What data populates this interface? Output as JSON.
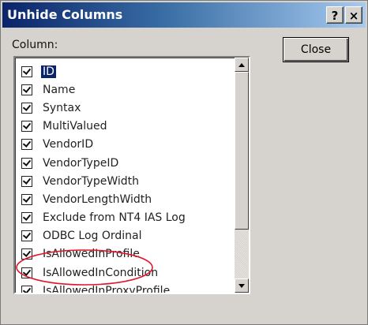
{
  "window": {
    "title": "Unhide Columns",
    "help_button": "?",
    "close_glyph": "×"
  },
  "columns_label": "Column:",
  "close_button_label": "Close",
  "columns": [
    {
      "label": "ID",
      "checked": true,
      "selected": true
    },
    {
      "label": "Name",
      "checked": true
    },
    {
      "label": "Syntax",
      "checked": true
    },
    {
      "label": "MultiValued",
      "checked": true
    },
    {
      "label": "VendorID",
      "checked": true
    },
    {
      "label": "VendorTypeID",
      "checked": true
    },
    {
      "label": "VendorTypeWidth",
      "checked": true
    },
    {
      "label": "VendorLengthWidth",
      "checked": true
    },
    {
      "label": "Exclude from NT4 IAS Log",
      "checked": true
    },
    {
      "label": "ODBC Log Ordinal",
      "checked": true
    },
    {
      "label": "IsAllowedInProfile",
      "checked": true
    },
    {
      "label": "IsAllowedInCondition",
      "checked": true
    },
    {
      "label": "IsAllowedInProxyProfile",
      "checked": true
    }
  ],
  "annotation_color": "#e0162b",
  "colors": {
    "dialog_bg": "#d6d3ce",
    "titlebar_start": "#0a246a",
    "titlebar_end": "#a6caf0",
    "selection": "#0a246a"
  }
}
